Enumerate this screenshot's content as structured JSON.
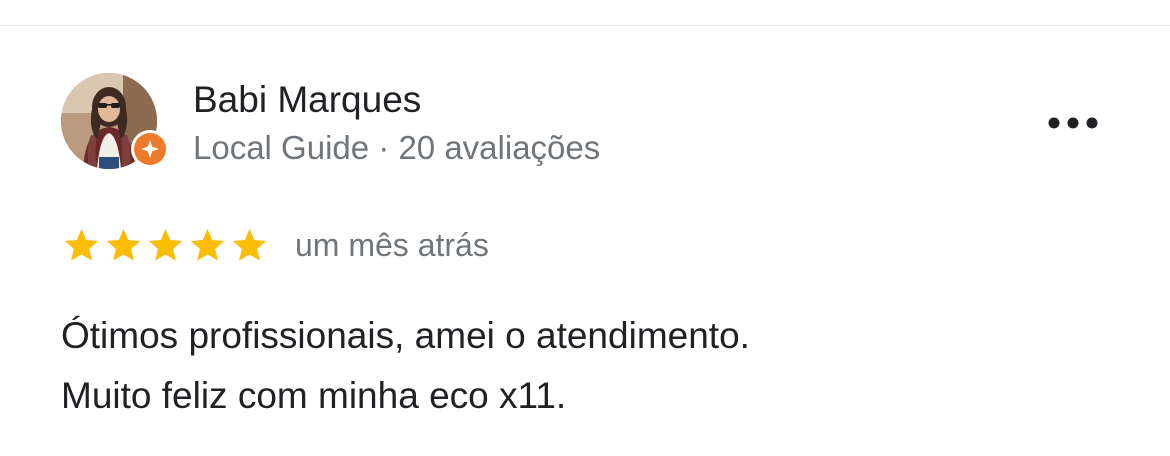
{
  "review": {
    "reviewer_name": "Babi Marques",
    "reviewer_meta": "Local Guide · 20 avaliações",
    "badge_icon": "local-guide-star-icon",
    "badge_color": "#ee7a2c",
    "more_icon": "more-horizontal-icon",
    "rating": 5,
    "rating_max": 5,
    "star_color": "#fbbc04",
    "date": "um mês atrás",
    "text_lines": [
      "Ótimos profissionais, amei o atendimento.",
      "Muito feliz com minha eco x11."
    ]
  }
}
